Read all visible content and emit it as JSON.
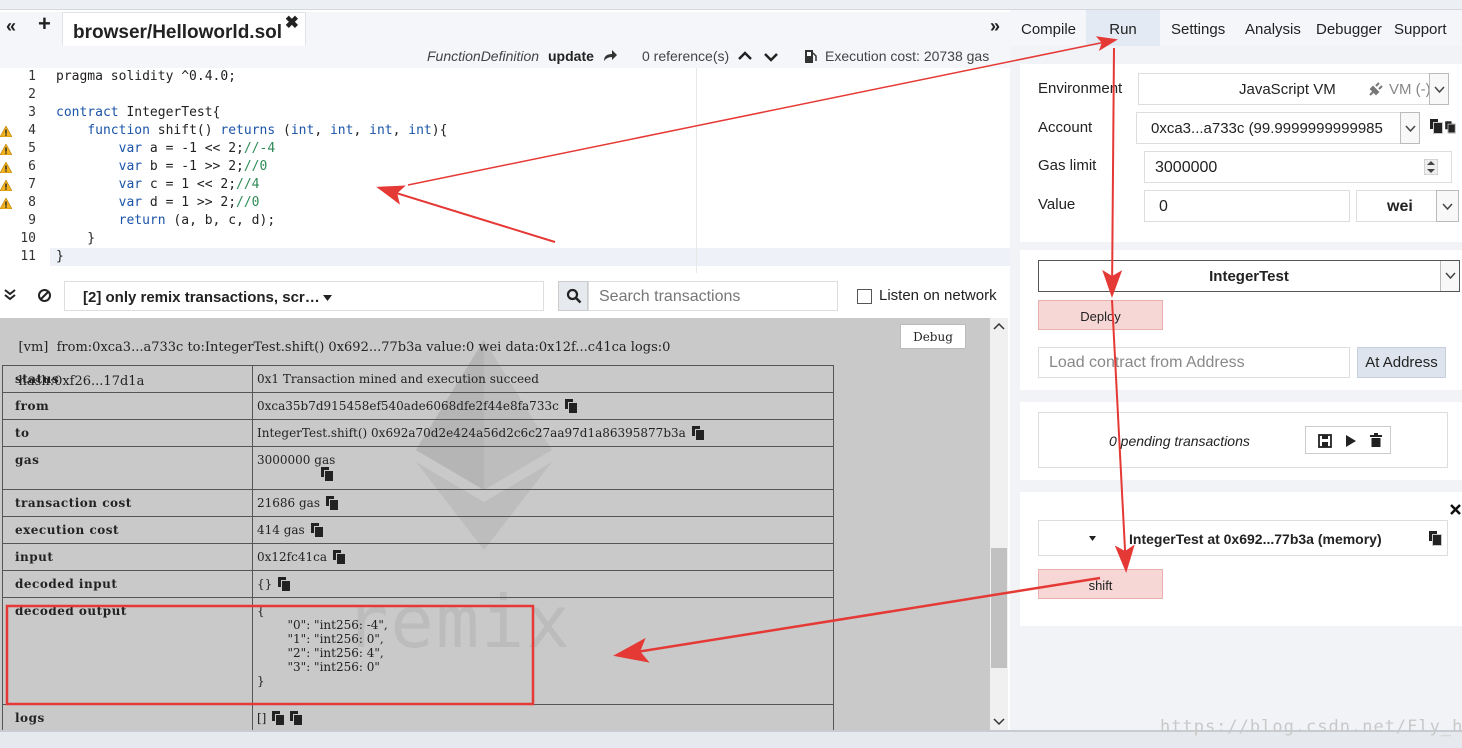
{
  "editor_tabs": {
    "file_name": "browser/Helloworld.sol",
    "collapse_glyph": "«",
    "add_glyph": "+",
    "close_glyph": "✖",
    "more_glyph": "»"
  },
  "right_tabs": [
    "Compile",
    "Run",
    "Settings",
    "Analysis",
    "Debugger",
    "Support"
  ],
  "fn_bar": {
    "kind": "FunctionDefinition",
    "name": "update",
    "refs": "0 reference(s)",
    "cost": "Execution cost: 20738 gas"
  },
  "code_lines": [
    {
      "n": "1",
      "html": "pragma solidity ^0.4.0;",
      "warn": false
    },
    {
      "n": "2",
      "html": "",
      "warn": false
    },
    {
      "n": "3",
      "html": "<span class=kw>contract</span> IntegerTest{",
      "warn": false
    },
    {
      "n": "4",
      "html": "    <span class=kw>function</span> shift() <span class=kw>returns</span> (<span class=kw>int</span>, <span class=kw>int</span>, <span class=kw>int</span>, <span class=kw>int</span>){",
      "warn": true
    },
    {
      "n": "5",
      "html": "        <span class=kw>var</span> a = -1 &lt;&lt; 2;<span class=cm>//-4</span>",
      "warn": true
    },
    {
      "n": "6",
      "html": "        <span class=kw>var</span> b = -1 &gt;&gt; 2;<span class=cm>//0</span>",
      "warn": true
    },
    {
      "n": "7",
      "html": "        <span class=kw>var</span> c = 1 &lt;&lt; 2;<span class=cm>//4</span>",
      "warn": true
    },
    {
      "n": "8",
      "html": "        <span class=kw>var</span> d = 1 &gt;&gt; 2;<span class=cm>//0</span>",
      "warn": true
    },
    {
      "n": "9",
      "html": "        <span class=kw>return</span> (a, b, c, d);",
      "warn": false
    },
    {
      "n": "10",
      "html": "    }",
      "warn": false
    },
    {
      "n": "11",
      "html": "}",
      "warn": false
    }
  ],
  "terminal": {
    "filter": "[2] only remix transactions, scr…",
    "search_placeholder": "Search transactions",
    "listen": "Listen on network",
    "tx_line1": "[vm]  from:0xca3...a733c to:IntegerTest.shift() 0x692...77b3a value:0 wei data:0x12f...c41ca logs:0",
    "tx_line2": "hash:0xf26...17d1a",
    "debug": "Debug",
    "rows": [
      {
        "k": "status",
        "v": "0x1 Transaction mined and execution succeed",
        "copy": false
      },
      {
        "k": "from",
        "v": "0xca35b7d915458ef540ade6068dfe2f44e8fa733c",
        "copy": true
      },
      {
        "k": "to",
        "v": "IntegerTest.shift() 0x692a70d2e424a56d2c6c27aa97d1a86395877b3a",
        "copy": true
      },
      {
        "k": "gas",
        "v": "3000000 gas",
        "copy": true
      },
      {
        "k": "transaction cost",
        "v": "21686 gas",
        "copy": true
      },
      {
        "k": "execution cost",
        "v": "414 gas",
        "copy": true
      },
      {
        "k": "input",
        "v": "0x12fc41ca",
        "copy": true
      },
      {
        "k": "decoded input",
        "v": "{}",
        "copy": true
      },
      {
        "k": "decoded output",
        "v": "{\n        \"0\": \"int256: -4\",\n        \"1\": \"int256: 0\",\n        \"2\": \"int256: 4\",\n        \"3\": \"int256: 0\"\n}",
        "copy": false
      },
      {
        "k": "logs",
        "v": "[]",
        "copy": true
      }
    ],
    "watermark": "remix"
  },
  "run_panel": {
    "environment_label": "Environment",
    "environment_value": "JavaScript VM",
    "vm_badge": "VM (-)",
    "account_label": "Account",
    "account_value": "0xca3...a733c (99.9999999999985",
    "gas_label": "Gas limit",
    "gas_value": "3000000",
    "value_label": "Value",
    "value_value": "0",
    "unit": "wei",
    "contract_select": "IntegerTest",
    "deploy": "Deploy",
    "load_placeholder": "Load contract from Address",
    "at_address": "At Address",
    "pending": "0 pending transactions",
    "instance_title": "IntegerTest at 0x692...77b3a (memory)",
    "shift": "shift"
  },
  "page_watermark": "https://blog.csdn.net/Fly_hps",
  "colors": {
    "annotation": "#e53935",
    "keyword": "#1b54a8",
    "comment": "#2e8b57",
    "deploy_bg": "#f7d6d6"
  }
}
